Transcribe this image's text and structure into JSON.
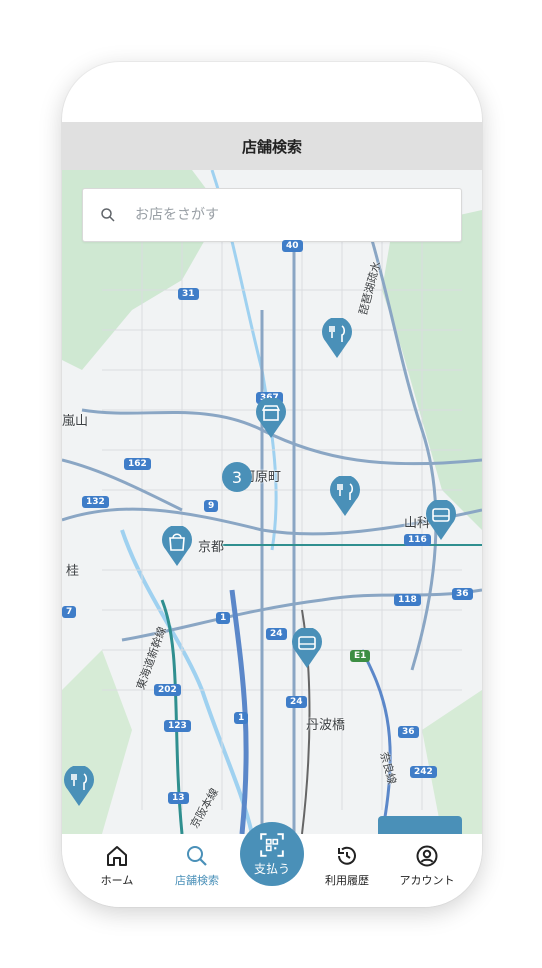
{
  "header": {
    "title": "店舗検索"
  },
  "search": {
    "placeholder": "お店をさがす"
  },
  "map": {
    "labels": {
      "arashiyama": "嵐山",
      "katsura": "桂",
      "kyoto": "京都",
      "kawaramachi": "河原町",
      "yamashina": "山科",
      "tanbabashi": "丹波橋",
      "shinkansen": "東海道新幹線",
      "keihan": "京阪本線",
      "biwako": "琵琶湖疏水",
      "nara_line": "奈良線"
    },
    "roads": [
      "40",
      "31",
      "367",
      "162",
      "9",
      "132",
      "116",
      "118",
      "36",
      "1",
      "24",
      "E1",
      "202",
      "123",
      "1",
      "24",
      "36",
      "242",
      "13",
      "7"
    ],
    "cluster_count": "3"
  },
  "tabbar": {
    "home": "ホーム",
    "search": "店舗検索",
    "pay": "支払う",
    "history": "利用履歴",
    "account": "アカウント"
  },
  "colors": {
    "accent": "#4a90b8",
    "header_bg": "#e0e0e0"
  }
}
